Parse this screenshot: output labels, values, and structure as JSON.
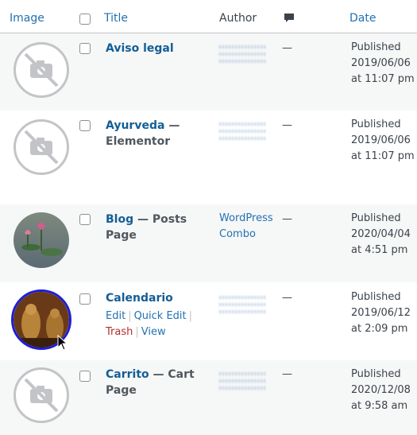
{
  "header": {
    "image": "Image",
    "title": "Title",
    "author": "Author",
    "comments_icon": "comment-bubble-icon",
    "date": "Date"
  },
  "rows": [
    {
      "title": "Aviso legal",
      "state": "",
      "author": "",
      "comments": "—",
      "status": "Published",
      "date": "2019/06/06",
      "time": "at 11:07 pm",
      "thumb": "no-image-placeholder"
    },
    {
      "title": "Ayurveda",
      "state": "— Elementor",
      "author": "",
      "comments": "—",
      "status": "Published",
      "date": "2019/06/06",
      "time": "at 11:07 pm",
      "thumb": "no-image-placeholder"
    },
    {
      "title": "Blog",
      "state": "— Posts Page",
      "author_line1": "WordPress",
      "author_line2": "Combo",
      "comments": "—",
      "status": "Published",
      "date": "2020/04/04",
      "time": "at 4:51 pm",
      "thumb": "lotus-pond-photo"
    },
    {
      "title": "Calendario",
      "state": "",
      "author": "",
      "comments": "—",
      "status": "Published",
      "date": "2019/06/12",
      "time": "at 2:09 pm",
      "thumb": "buddha-statues-photo",
      "actions": {
        "edit": "Edit",
        "quick_edit": "Quick Edit",
        "trash": "Trash",
        "view": "View",
        "sep": "|"
      }
    },
    {
      "title": "Carrito",
      "state": "— Cart Page",
      "author": "",
      "comments": "—",
      "status": "Published",
      "date": "2020/12/08",
      "time": "at 9:58 am",
      "thumb": "no-image-placeholder"
    }
  ],
  "colors": {
    "link": "#2271b1",
    "title": "#135e96",
    "trash": "#b32d2e",
    "alt_row": "#f6f7f7",
    "selected_ring": "#1e1ed8"
  }
}
